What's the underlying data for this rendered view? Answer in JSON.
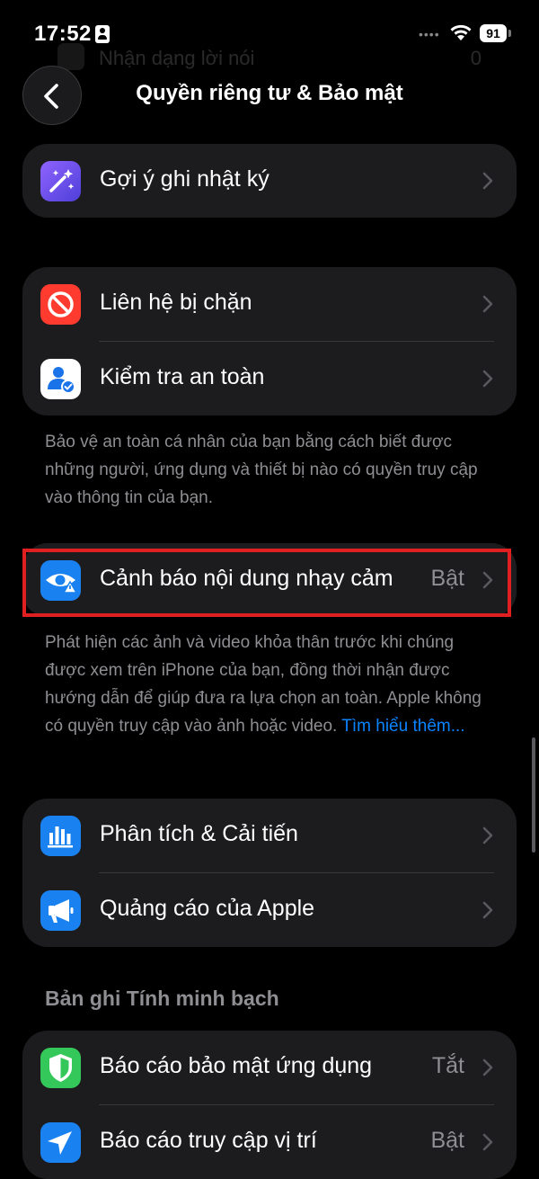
{
  "status_bar": {
    "time": "17:52",
    "battery": "91"
  },
  "ghost_row": {
    "label": "Nhận dạng lời nói",
    "value": "0"
  },
  "header": {
    "title": "Quyền riêng tư & Bảo mật"
  },
  "group1": {
    "rows": [
      {
        "label": "Gợi ý ghi nhật ký",
        "icon": "journaling-suggestions-icon"
      }
    ]
  },
  "group2": {
    "rows": [
      {
        "label": "Liên hệ bị chặn",
        "icon": "blocked-contacts-icon"
      },
      {
        "label": "Kiểm tra an toàn",
        "icon": "safety-check-icon"
      }
    ],
    "footer": "Bảo vệ an toàn cá nhân của bạn bằng cách biết được những người, ứng dụng và thiết bị nào có quyền truy cập vào thông tin của bạn."
  },
  "group3": {
    "rows": [
      {
        "label": "Cảnh báo nội dung nhạy cảm",
        "value": "Bật",
        "icon": "sensitive-content-warning-icon"
      }
    ],
    "footer": "Phát hiện các ảnh và video khỏa thân trước khi chúng được xem trên iPhone của bạn, đồng thời nhận được hướng dẫn để giúp đưa ra lựa chọn an toàn. Apple không có quyền truy cập vào ảnh hoặc video.",
    "footer_link": "Tìm hiểu thêm..."
  },
  "group4": {
    "rows": [
      {
        "label": "Phân tích & Cải tiến",
        "icon": "analytics-icon"
      },
      {
        "label": "Quảng cáo của Apple",
        "icon": "apple-advertising-icon"
      }
    ]
  },
  "group5": {
    "header": "Bản ghi Tính minh bạch",
    "rows": [
      {
        "label": "Báo cáo bảo mật ứng dụng",
        "value": "Tắt",
        "icon": "app-privacy-report-icon"
      },
      {
        "label": "Báo cáo truy cập vị trí",
        "value": "Bật",
        "icon": "location-access-report-icon"
      }
    ]
  },
  "colors": {
    "accent": "#0a84ff",
    "highlight": "#e02020",
    "cell": "#1c1c1e",
    "secondary_text": "#8e8e93"
  }
}
